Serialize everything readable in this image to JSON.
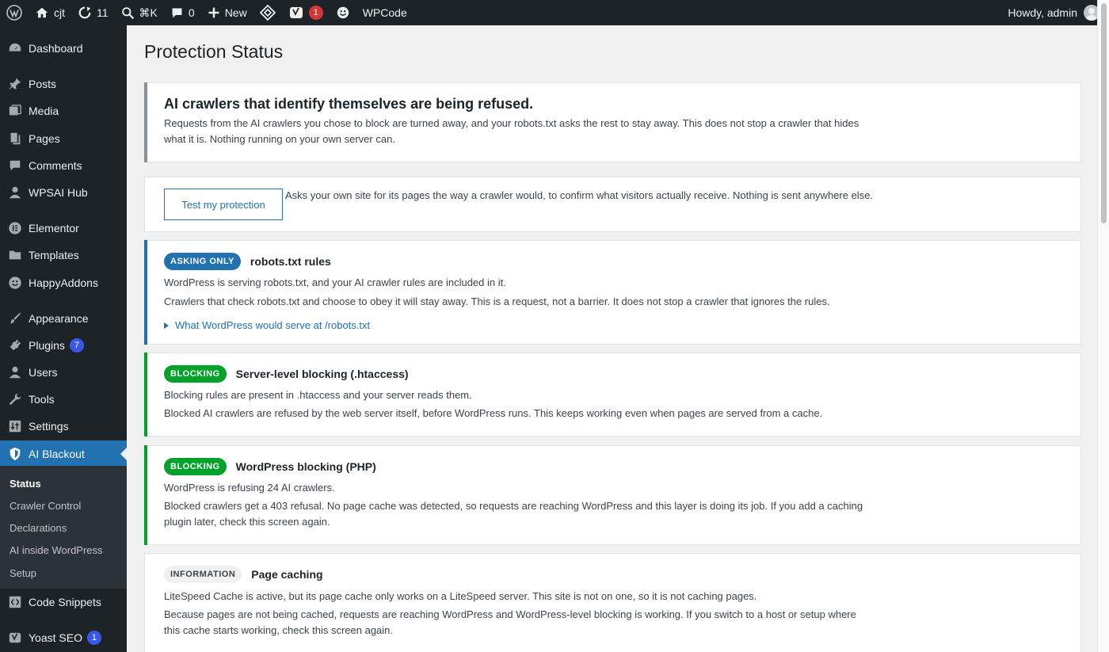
{
  "admin_bar": {
    "site_name": "cjt",
    "updates_count": "11",
    "search_shortcut": "⌘K",
    "comments_count": "0",
    "new_label": "New",
    "yoast_badge": "1",
    "wpcode_label": "WPCode",
    "howdy": "Howdy, admin"
  },
  "sidebar": {
    "items": [
      {
        "label": "Dashboard",
        "icon": "dashboard-icon"
      },
      {
        "label": "Posts",
        "icon": "pin-icon"
      },
      {
        "label": "Media",
        "icon": "media-icon"
      },
      {
        "label": "Pages",
        "icon": "pages-icon"
      },
      {
        "label": "Comments",
        "icon": "comment-icon"
      },
      {
        "label": "WPSAI Hub",
        "icon": "user-icon"
      },
      {
        "label": "Elementor",
        "icon": "elementor-icon"
      },
      {
        "label": "Templates",
        "icon": "folder-icon"
      },
      {
        "label": "HappyAddons",
        "icon": "happy-icon"
      },
      {
        "label": "Appearance",
        "icon": "brush-icon"
      },
      {
        "label": "Plugins",
        "icon": "plugin-icon",
        "count": "7"
      },
      {
        "label": "Users",
        "icon": "user-icon"
      },
      {
        "label": "Tools",
        "icon": "wrench-icon"
      },
      {
        "label": "Settings",
        "icon": "sliders-icon"
      },
      {
        "label": "AI Blackout",
        "icon": "shield-icon"
      },
      {
        "label": "Code Snippets",
        "icon": "code-icon"
      },
      {
        "label": "Yoast SEO",
        "icon": "yoast-icon",
        "count": "1"
      }
    ],
    "submenu": [
      "Status",
      "Crawler Control",
      "Declarations",
      "AI inside WordPress",
      "Setup"
    ]
  },
  "page": {
    "title": "Protection Status",
    "summary": {
      "title": "AI crawlers that identify themselves are being refused.",
      "text": "Requests from the AI crawlers you chose to block are turned away, and your robots.txt asks the rest to stay away. This does not stop a crawler that hides what it is. Nothing running on your own server can."
    },
    "test": {
      "button": "Test my protection",
      "text": "Asks your own site for its pages the way a crawler would, to confirm what visitors actually receive. Nothing is sent anywhere else."
    },
    "layers": [
      {
        "badge": "ASKING ONLY",
        "title": "robots.txt rules",
        "line1": "WordPress is serving robots.txt, and your AI crawler rules are included in it.",
        "line2": "Crawlers that check robots.txt and choose to obey it will stay away. This is a request, not a barrier. It does not stop a crawler that ignores the rules.",
        "details": "What WordPress would serve at /robots.txt"
      },
      {
        "badge": "BLOCKING",
        "title": "Server-level blocking (.htaccess)",
        "line1": "Blocking rules are present in .htaccess and your server reads them.",
        "line2": "Blocked AI crawlers are refused by the web server itself, before WordPress runs. This keeps working even when pages are served from a cache."
      },
      {
        "badge": "BLOCKING",
        "title": "WordPress blocking (PHP)",
        "line1": "WordPress is refusing 24 AI crawlers.",
        "line2": "Blocked crawlers get a 403 refusal. No page cache was detected, so requests are reaching WordPress and this layer is doing its job. If you add a caching plugin later, check this screen again."
      },
      {
        "badge": "INFORMATION",
        "title": "Page caching",
        "line1": "LiteSpeed Cache is active, but its page cache only works on a LiteSpeed server. This site is not on one, so it is not caching pages.",
        "line2": "Because pages are not being cached, requests are reaching WordPress and WordPress-level blocking is working. If you switch to a host or setup where this cache starts working, check this screen again."
      }
    ]
  },
  "colors": {
    "admin_bg": "#1d2327",
    "accent": "#2271b1",
    "blocking": "#00a32a",
    "badge_red": "#d63638",
    "count_blue": "#3858e9"
  }
}
